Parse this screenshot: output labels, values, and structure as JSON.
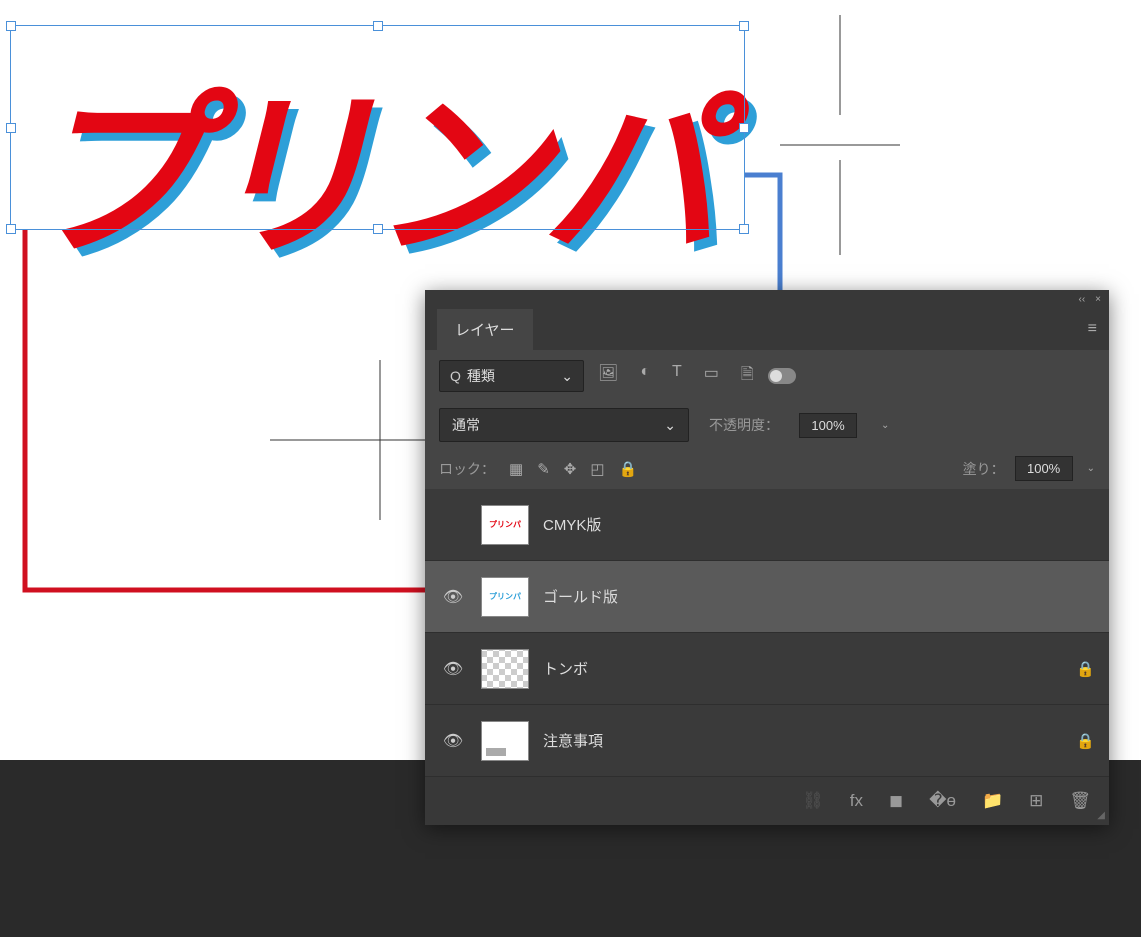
{
  "canvas": {
    "logo_text": "プリンパ",
    "shadow_color": "#2e9fd8",
    "main_color": "#e30613"
  },
  "panel": {
    "title": "レイヤー",
    "filter_label": "種類",
    "blend_mode": "通常",
    "opacity_label": "不透明度：",
    "opacity_value": "100%",
    "lock_label": "ロック：",
    "fill_label": "塗り：",
    "fill_value": "100%"
  },
  "layers": [
    {
      "name": "CMYK版",
      "visible": false,
      "selected": false,
      "locked": false,
      "thumb": "red"
    },
    {
      "name": "ゴールド版",
      "visible": true,
      "selected": true,
      "locked": false,
      "thumb": "blue"
    },
    {
      "name": "トンボ",
      "visible": true,
      "selected": false,
      "locked": true,
      "thumb": "checker"
    },
    {
      "name": "注意事項",
      "visible": true,
      "selected": false,
      "locked": true,
      "thumb": "note"
    }
  ],
  "icons": {
    "collapse": "‹‹",
    "close": "×",
    "menu": "≡",
    "search": "Q",
    "caret": "⌄",
    "image_filter": "🖼",
    "adjust_filter": "◐",
    "type_filter": "T",
    "shape_filter": "▭",
    "smart_filter": "🗎",
    "eye": "👁",
    "lock": "🔒",
    "checker": "▦",
    "brush": "✎",
    "move": "✥",
    "crop": "◰",
    "link": "⛓",
    "fx": "fx",
    "mask": "◼",
    "fill_adj": "�ө",
    "folder": "📁",
    "new": "⊞",
    "trash": "🗑"
  }
}
